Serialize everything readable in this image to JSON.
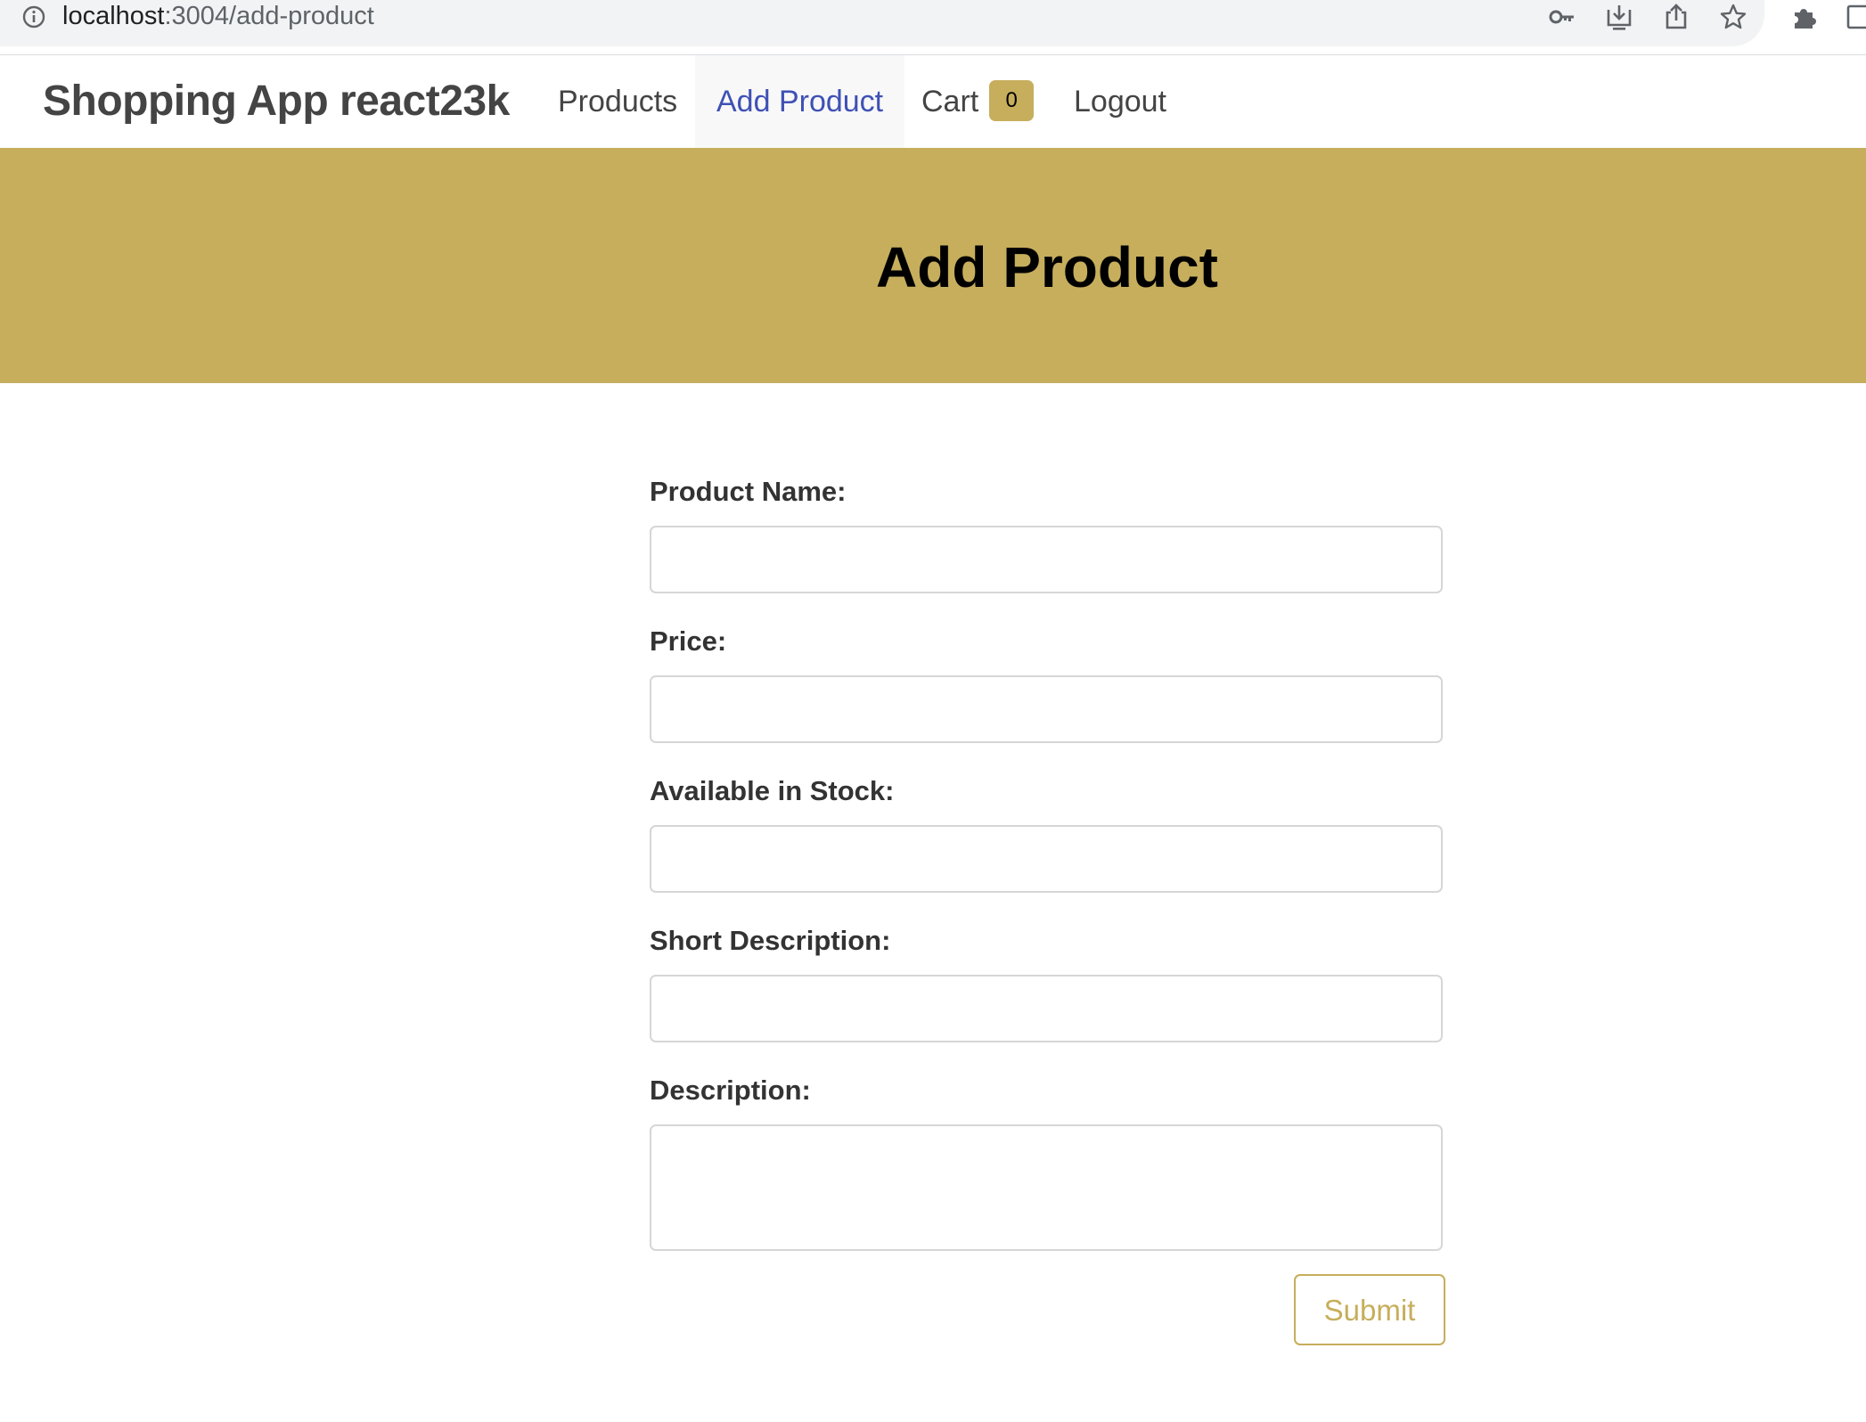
{
  "browser": {
    "url_host": "localhost",
    "url_path": ":3004/add-product",
    "icons": [
      "info-icon",
      "key-icon",
      "install-icon",
      "share-icon",
      "star-icon",
      "extensions-icon",
      "side-panel-icon"
    ]
  },
  "navbar": {
    "brand": "Shopping App react23k",
    "items": [
      {
        "label": "Products",
        "active": false
      },
      {
        "label": "Add Product",
        "active": true
      },
      {
        "label": "Cart",
        "active": false,
        "badge": "0"
      },
      {
        "label": "Logout",
        "active": false
      }
    ]
  },
  "hero": {
    "title": "Add Product"
  },
  "form": {
    "fields": [
      {
        "label": "Product Name:",
        "value": ""
      },
      {
        "label": "Price:",
        "value": ""
      },
      {
        "label": "Available in Stock:",
        "value": ""
      },
      {
        "label": "Short Description:",
        "value": ""
      },
      {
        "label": "Description:",
        "value": ""
      }
    ],
    "submit_label": "Submit"
  },
  "colors": {
    "accent": "#c6ae5c",
    "active_link": "#3f51b5",
    "nav_text": "#444444",
    "input_border": "#d6d6d6"
  }
}
